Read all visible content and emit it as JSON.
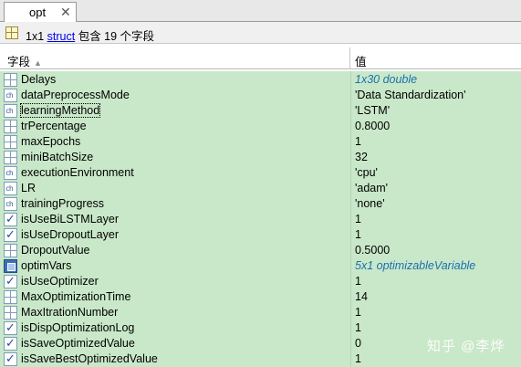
{
  "tab": {
    "label": "opt",
    "close": "✕"
  },
  "info": {
    "prefix": "1x1",
    "link": "struct",
    "suffix": "包含 19 个字段"
  },
  "header": {
    "field": "字段",
    "sort_icon": "▲",
    "value": "值"
  },
  "rows": [
    {
      "icon": "grid-icon",
      "name": "Delays",
      "value": "1x30 double",
      "italic": true
    },
    {
      "icon": "char-icon",
      "name": "dataPreprocessMode",
      "value": "'Data Standardization'"
    },
    {
      "icon": "char-icon",
      "name": "learningMethod",
      "value": "'LSTM'"
    },
    {
      "icon": "grid-icon",
      "name": "trPercentage",
      "value": "0.8000"
    },
    {
      "icon": "grid-icon",
      "name": "maxEpochs",
      "value": "1"
    },
    {
      "icon": "grid-icon",
      "name": "miniBatchSize",
      "value": "32"
    },
    {
      "icon": "char-icon",
      "name": "executionEnvironment",
      "value": "'cpu'"
    },
    {
      "icon": "char-icon",
      "name": "LR",
      "value": "'adam'"
    },
    {
      "icon": "char-icon",
      "name": "trainingProgress",
      "value": "'none'"
    },
    {
      "icon": "check-icon",
      "name": "isUseBiLSTMLayer",
      "value": "1"
    },
    {
      "icon": "check-icon",
      "name": "isUseDropoutLayer",
      "value": "1"
    },
    {
      "icon": "grid-icon",
      "name": "DropoutValue",
      "value": "0.5000"
    },
    {
      "icon": "object-icon",
      "name": "optimVars",
      "value": "5x1 optimizableVariable",
      "italic": true
    },
    {
      "icon": "check-icon",
      "name": "isUseOptimizer",
      "value": "1"
    },
    {
      "icon": "grid-icon",
      "name": "MaxOptimizationTime",
      "value": "14"
    },
    {
      "icon": "grid-icon",
      "name": "MaxItrationNumber",
      "value": "1"
    },
    {
      "icon": "check-icon",
      "name": "isDispOptimizationLog",
      "value": "1"
    },
    {
      "icon": "check-icon",
      "name": "isSaveOptimizedValue",
      "value": "0"
    },
    {
      "icon": "check-icon",
      "name": "isSaveBestOptimizedValue",
      "value": "1"
    }
  ],
  "focused_row": "learningMethod",
  "watermark": "知乎 @李烨",
  "colors": {
    "row_bg": "#c9e8c9",
    "link": "#0000ee",
    "italic_value": "#1a6fb0"
  }
}
